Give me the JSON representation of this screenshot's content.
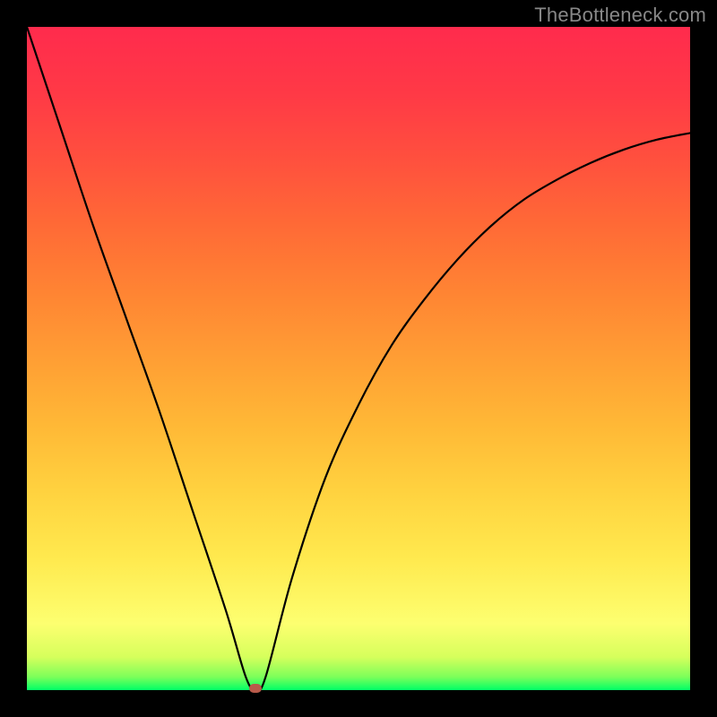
{
  "watermark": {
    "text": "TheBottleneck.com"
  },
  "chart_data": {
    "type": "line",
    "title": "",
    "xlabel": "",
    "ylabel": "",
    "xlim": [
      0,
      100
    ],
    "ylim": [
      0,
      100
    ],
    "grid": false,
    "legend": false,
    "background": "rainbow-gradient",
    "series": [
      {
        "name": "bottleneck-curve",
        "x": [
          0,
          5,
          10,
          15,
          20,
          25,
          30,
          33,
          34.5,
          36,
          40,
          45,
          50,
          55,
          60,
          65,
          70,
          75,
          80,
          85,
          90,
          95,
          100
        ],
        "y": [
          100,
          85,
          70,
          56,
          42,
          27,
          12,
          2,
          0,
          2,
          17,
          32,
          43,
          52,
          59,
          65,
          70,
          74,
          77,
          79.5,
          81.5,
          83,
          84
        ],
        "notes": "V-shaped curve; left branch near-linear descent from top-left corner to minimum near x≈34.5; right branch rises with diminishing slope toward upper right."
      }
    ],
    "marker": {
      "x": 34.5,
      "y": 0,
      "color": "#b85a4a"
    },
    "colors": {
      "curve": "#000000",
      "frame": "#000000",
      "gradient_stops": [
        "#00ff66",
        "#fdff70",
        "#ffb836",
        "#ff6a36",
        "#ff2b4d"
      ]
    }
  }
}
